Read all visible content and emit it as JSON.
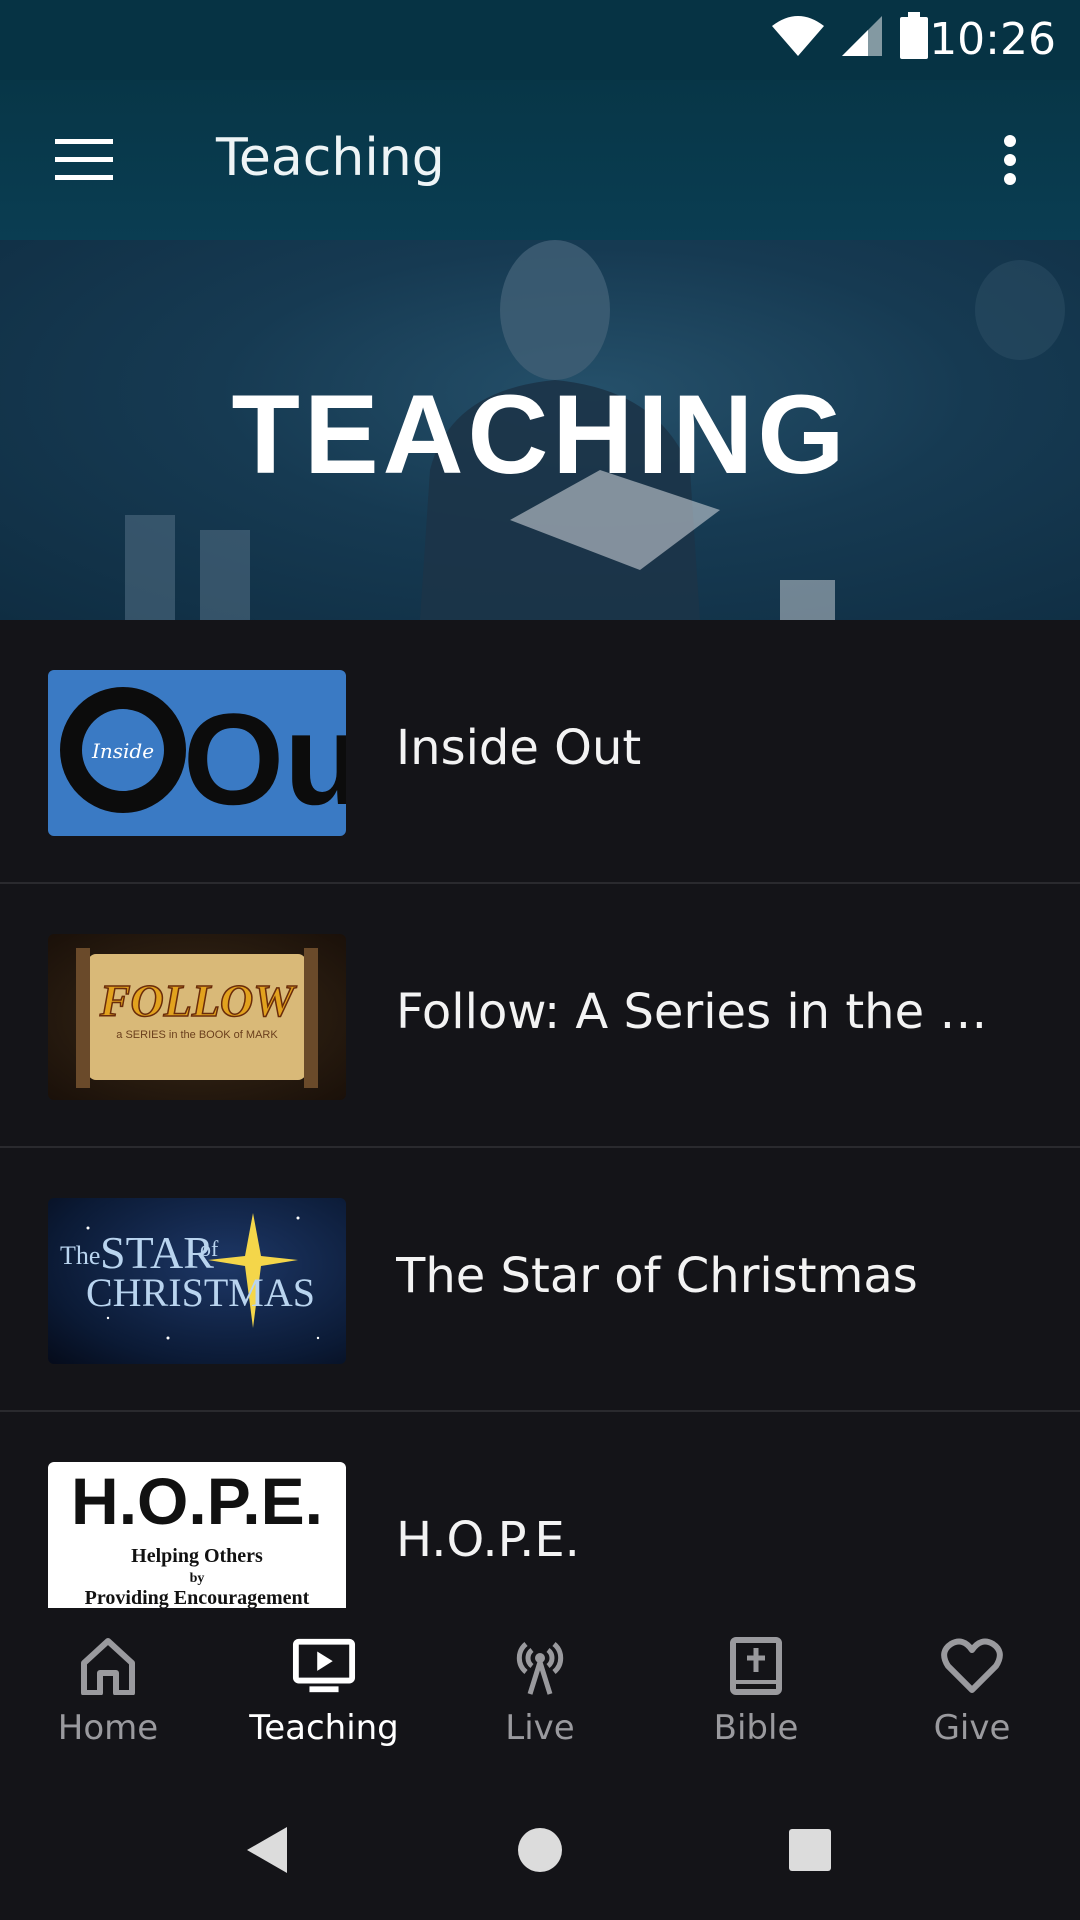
{
  "status_bar": {
    "time": "10:26"
  },
  "app_bar": {
    "title": "Teaching"
  },
  "hero": {
    "title": "TEACHING"
  },
  "series": [
    {
      "title": "Inside Out",
      "thumb_text_main": "Out",
      "thumb_text_small": "Inside"
    },
    {
      "title": "Follow: A Series in the Bo…",
      "thumb_text_main": "FOLLOW",
      "thumb_text_small": "a SERIES in the BOOK of MARK"
    },
    {
      "title": "The Star of Christmas",
      "thumb_text_a": "The",
      "thumb_text_b": "STAR",
      "thumb_text_c": "of",
      "thumb_text_d": "CHRISTMAS"
    },
    {
      "title": "H.O.P.E.",
      "thumb_text_main": "H.O.P.E.",
      "thumb_line1": "Helping Others",
      "thumb_line2": "by",
      "thumb_line3": "Providing Encouragement"
    }
  ],
  "bottom_nav": [
    {
      "label": "Home",
      "icon": "home-icon"
    },
    {
      "label": "Teaching",
      "icon": "tv-play-icon",
      "active": true
    },
    {
      "label": "Live",
      "icon": "broadcast-icon"
    },
    {
      "label": "Bible",
      "icon": "bible-icon"
    },
    {
      "label": "Give",
      "icon": "heart-icon"
    }
  ],
  "colors": {
    "app_bar": "#073647",
    "background": "#141418",
    "inactive_nav": "#9a9a9e"
  }
}
